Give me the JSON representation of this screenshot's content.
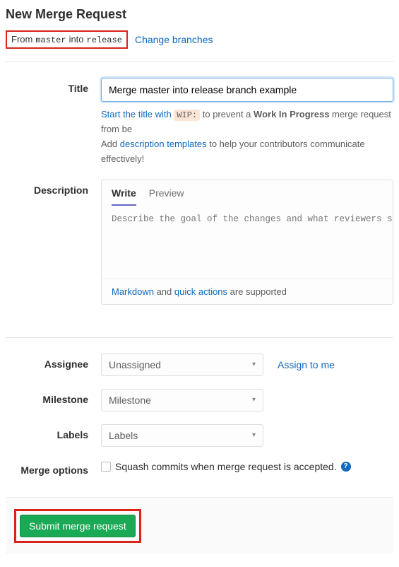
{
  "header": {
    "page_title": "New Merge Request",
    "from_word": "From",
    "into_word": "into",
    "source_branch": "master",
    "target_branch": "release",
    "change_branches": "Change branches"
  },
  "title_section": {
    "label": "Title",
    "value": "Merge master into release branch example",
    "help_pre": "Start the title with ",
    "wip_code": "WIP:",
    "help_mid": " to prevent a ",
    "wip_bold": "Work In Progress",
    "help_post": " merge request from be",
    "help2_pre": "Add ",
    "help2_link": "description templates",
    "help2_post": " to help your contributors communicate effectively!"
  },
  "description_section": {
    "label": "Description",
    "tab_write": "Write",
    "tab_preview": "Preview",
    "placeholder": "Describe the goal of the changes and what reviewers should be ",
    "footer_link1": "Markdown",
    "footer_mid": " and ",
    "footer_link2": "quick actions",
    "footer_post": " are supported"
  },
  "assignee": {
    "label": "Assignee",
    "value": "Unassigned",
    "assign_to_me": "Assign to me"
  },
  "milestone": {
    "label": "Milestone",
    "value": "Milestone"
  },
  "labels": {
    "label": "Labels",
    "value": "Labels"
  },
  "merge_options": {
    "label": "Merge options",
    "squash_text": "Squash commits when merge request is accepted."
  },
  "submit": {
    "label": "Submit merge request"
  }
}
